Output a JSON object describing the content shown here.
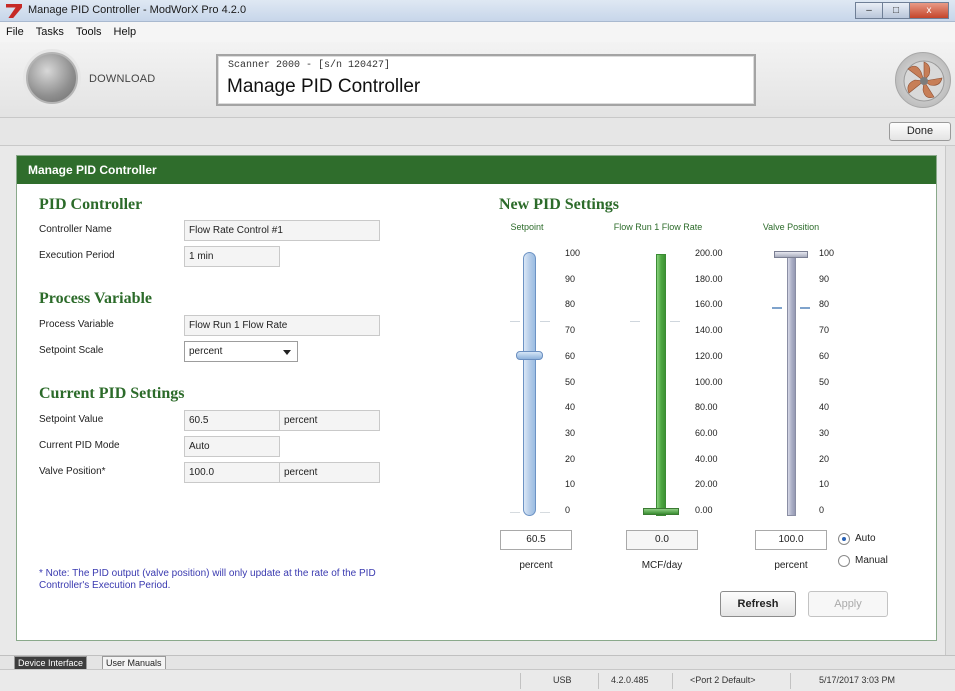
{
  "window": {
    "title": "Manage PID Controller - ModWorX Pro 4.2.0",
    "minimize_glyph": "–",
    "maximize_glyph": "□",
    "close_glyph": "x"
  },
  "menu": {
    "items": [
      "File",
      "Tasks",
      "Tools",
      "Help"
    ]
  },
  "header": {
    "download_label": "DOWNLOAD",
    "device_line": "Scanner 2000 -  [s/n 120427]",
    "screen_title": "Manage PID Controller"
  },
  "toolbar": {
    "done_label": "Done"
  },
  "panel": {
    "header": "Manage PID Controller",
    "pid_controller": {
      "title": "PID Controller",
      "name_label": "Controller Name",
      "name_value": "Flow Rate Control #1",
      "period_label": "Execution Period",
      "period_value": "1 min"
    },
    "process_variable": {
      "title": "Process Variable",
      "pv_label": "Process Variable",
      "pv_value": "Flow Run 1 Flow Rate",
      "scale_label": "Setpoint Scale",
      "scale_value": "percent"
    },
    "current_settings": {
      "title": "Current PID Settings",
      "setpoint_label": "Setpoint Value",
      "setpoint_value": "60.5",
      "setpoint_unit": "percent",
      "mode_label": "Current PID Mode",
      "mode_value": "Auto",
      "valve_label": "Valve Position*",
      "valve_value": "100.0",
      "valve_unit": "percent"
    },
    "note": "* Note: The PID output (valve position) will only update at the rate of the PID Controller's Execution Period."
  },
  "new_settings": {
    "title": "New PID Settings",
    "setpoint": {
      "label": "Setpoint",
      "ticks": [
        "100",
        "90",
        "80",
        "70",
        "60",
        "50",
        "40",
        "30",
        "20",
        "10",
        "0"
      ],
      "level_percent": 60.5,
      "value": "60.5",
      "unit": "percent"
    },
    "flow_rate": {
      "label": "Flow Run 1 Flow Rate",
      "ticks": [
        "200.00",
        "180.00",
        "160.00",
        "140.00",
        "120.00",
        "100.00",
        "80.00",
        "60.00",
        "40.00",
        "20.00",
        "0.00"
      ],
      "level_percent": 0,
      "value": "0.0",
      "unit": "MCF/day"
    },
    "valve_position": {
      "label": "Valve Position",
      "ticks": [
        "100",
        "90",
        "80",
        "70",
        "60",
        "50",
        "40",
        "30",
        "20",
        "10",
        "0"
      ],
      "level_percent": 100,
      "value": "100.0",
      "unit": "percent"
    },
    "mode": {
      "auto_label": "Auto",
      "manual_label": "Manual",
      "selected": "Auto"
    },
    "refresh_label": "Refresh",
    "apply_label": "Apply"
  },
  "bottom_tabs": [
    "Device Interface",
    "User Manuals"
  ],
  "status": {
    "connection": "USB",
    "version": "4.2.0.485",
    "port": "<Port 2 Default>",
    "datetime": "5/17/2017 3:03 PM"
  },
  "colors": {
    "accent_green": "#2f6d2c",
    "setpoint_blue": "#9bbde2",
    "flow_green": "#4ea842",
    "valve_gray": "#adb1c8"
  }
}
